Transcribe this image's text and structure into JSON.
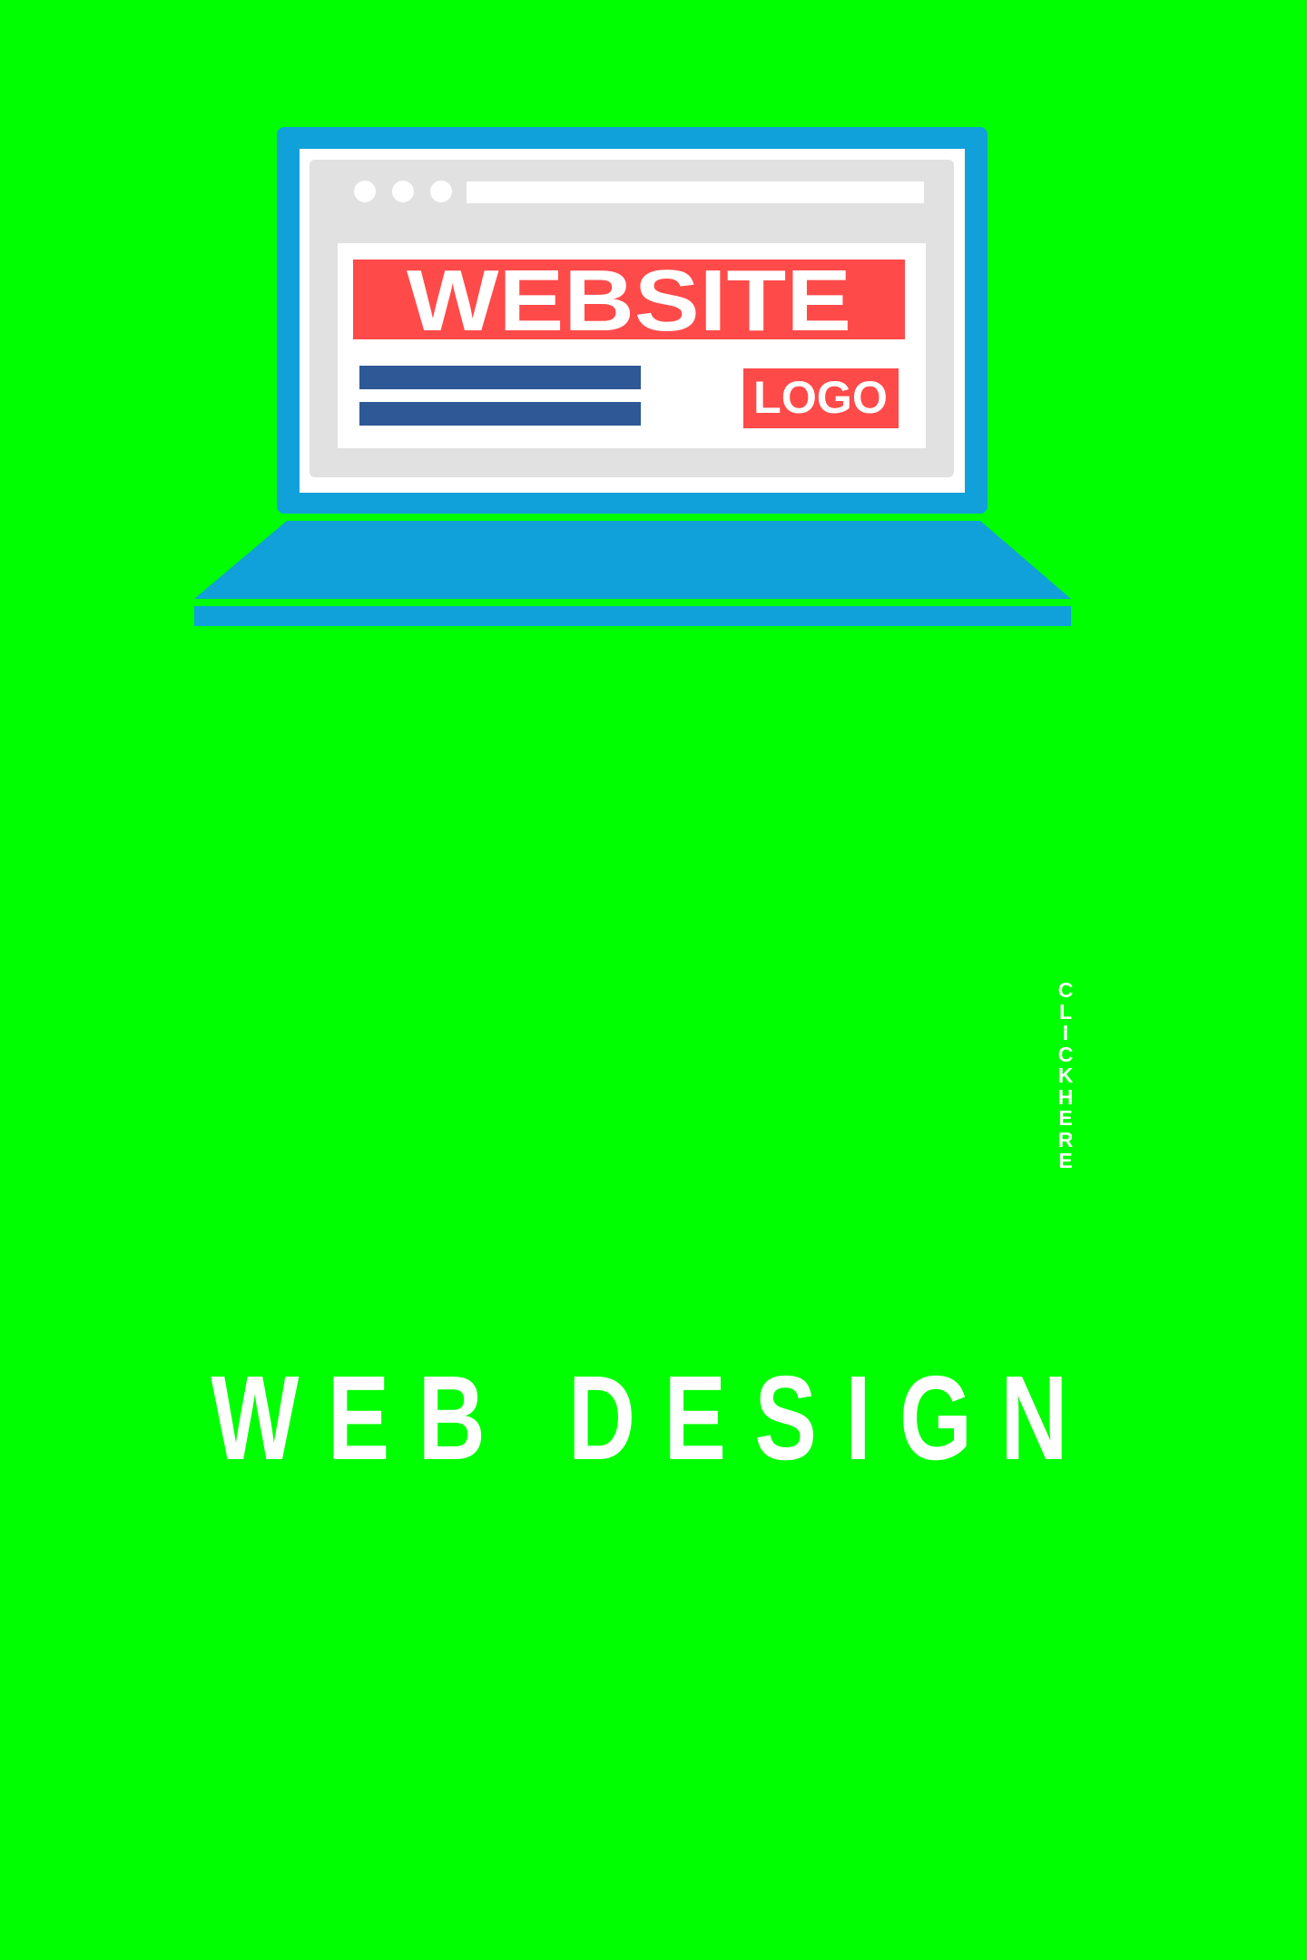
{
  "illustration": {
    "website_label": "WEBSITE",
    "logo_label": "LOGO"
  },
  "cta": {
    "label": "CLICK HERE"
  },
  "headline": {
    "text": "WEB DESIGN"
  },
  "colors": {
    "background": "#00FF00",
    "laptop_body": "#10A1DA",
    "screen_bezel": "#FFFFFF",
    "browser_chrome": "#E1E1E1",
    "page": "#FFFFFF",
    "banner_red": "#FF4A4A",
    "text_lines": "#2E5896",
    "text_white": "#FFFFFF"
  }
}
